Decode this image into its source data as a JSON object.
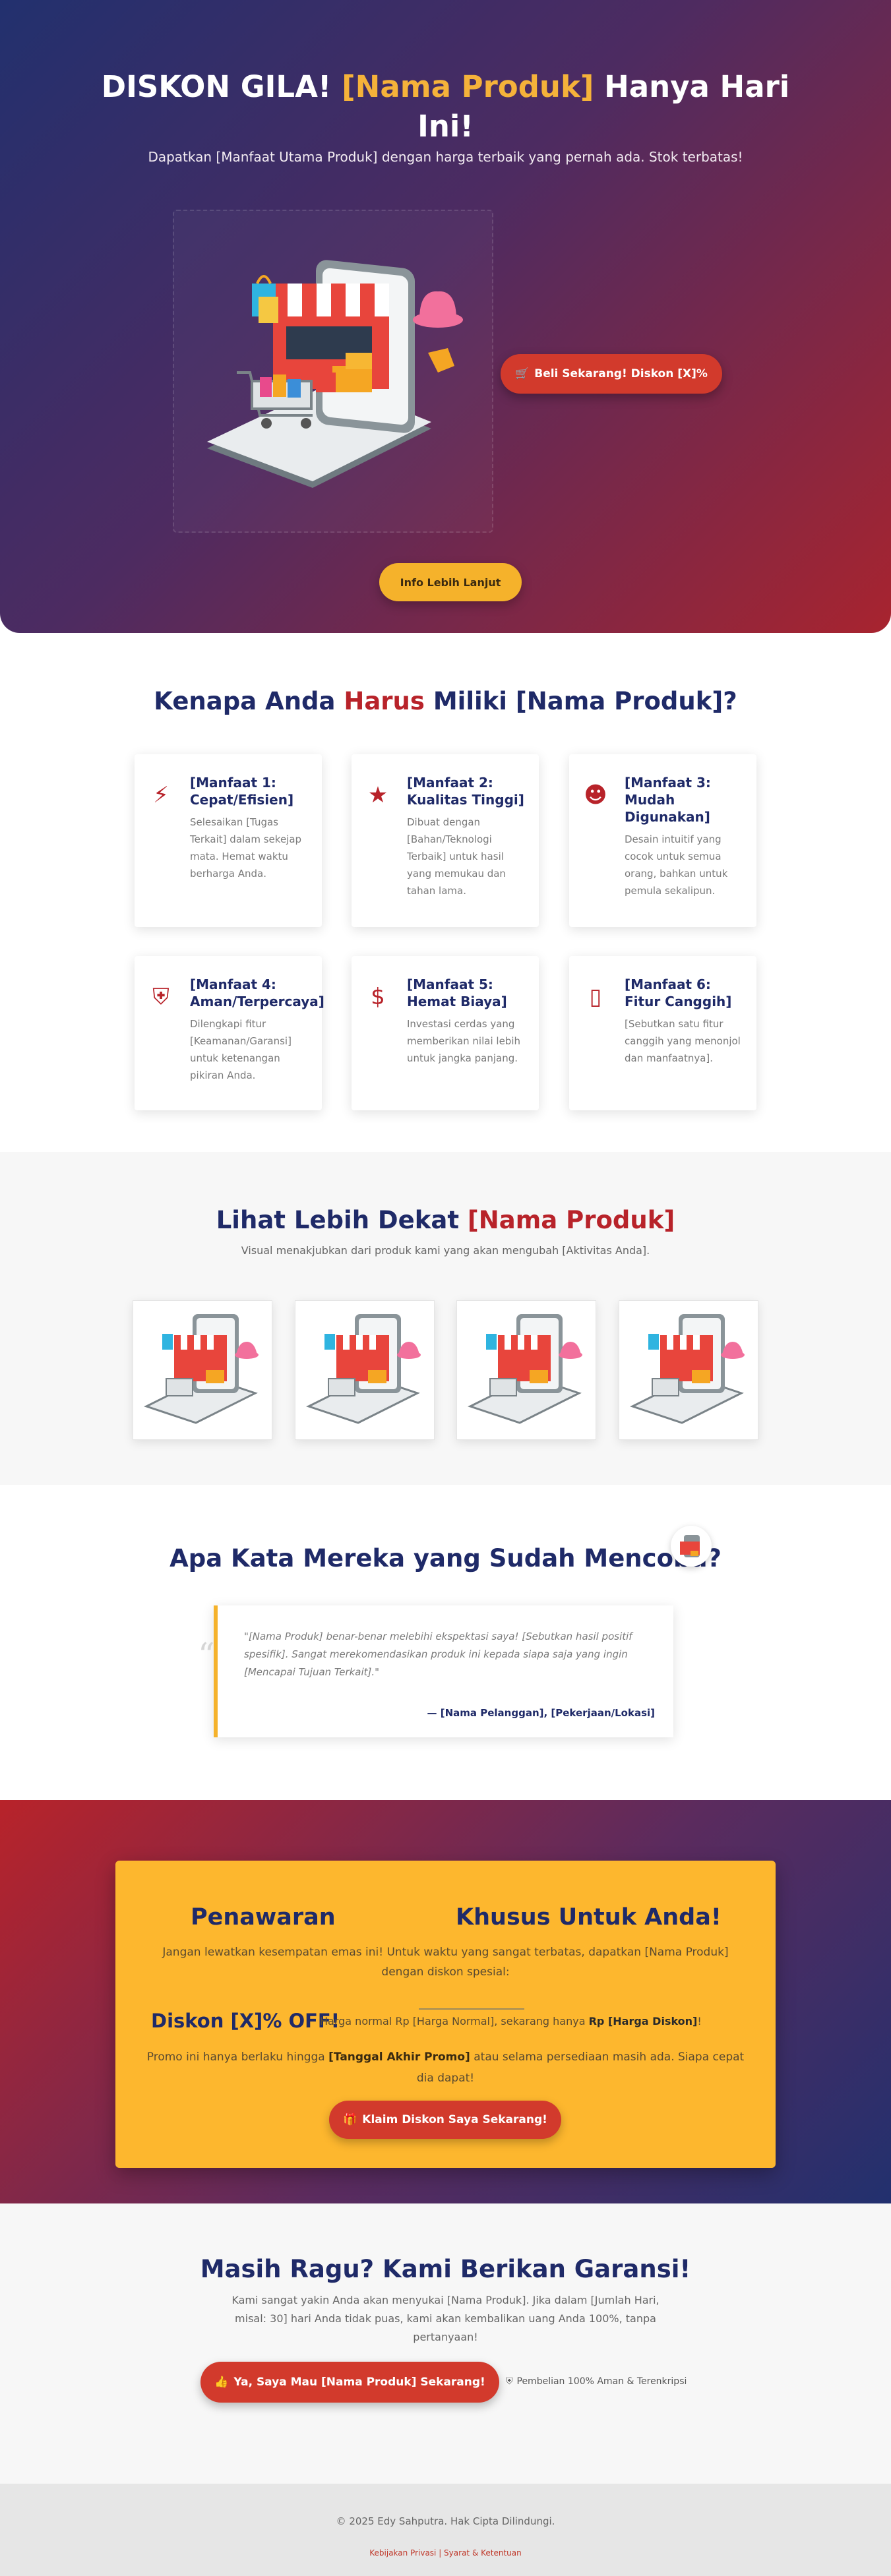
{
  "hero": {
    "title_prefix": "DISKON GILA!",
    "title_product": "[Nama Produk]",
    "title_suffix": "Hanya Hari Ini!",
    "subtitle": "Dapatkan [Manfaat Utama Produk] dengan harga terbaik yang pernah ada. Stok terbatas!",
    "buy_button": "Beli Sekarang! Diskon [X]%",
    "info_button": "Info Lebih Lanjut"
  },
  "benefits": {
    "title_a": "Kenapa Anda",
    "title_b": "Harus",
    "title_c": "Miliki [Nama Produk]?",
    "items": [
      {
        "icon": "bolt-icon",
        "glyph": "⚡",
        "title": "[Manfaat 1: Cepat/Efisien]",
        "text": "Selesaikan [Tugas Terkait] dalam sekejap mata. Hemat waktu berharga Anda."
      },
      {
        "icon": "star-icon",
        "glyph": "★",
        "title": "[Manfaat 2: Kualitas Tinggi]",
        "text": "Dibuat dengan [Bahan/Teknologi Terbaik] untuk hasil yang memukau dan tahan lama."
      },
      {
        "icon": "smile-icon",
        "glyph": "☻",
        "title": "[Manfaat 3: Mudah Digunakan]",
        "text": "Desain intuitif yang cocok untuk semua orang, bahkan untuk pemula sekalipun."
      },
      {
        "icon": "shield-icon",
        "glyph": "⛨",
        "title": "[Manfaat 4: Aman/Terpercaya]",
        "text": "Dilengkapi fitur [Keamanan/Garansi] untuk ketenangan pikiran Anda."
      },
      {
        "icon": "dollar-icon",
        "glyph": "$",
        "title": "[Manfaat 5: Hemat Biaya]",
        "text": "Investasi cerdas yang memberikan nilai lebih untuk jangka panjang."
      },
      {
        "icon": "mobile-icon",
        "glyph": "▯",
        "title": "[Manfaat 6: Fitur Canggih]",
        "text": "[Sebutkan satu fitur canggih yang menonjol dan manfaatnya]."
      }
    ]
  },
  "gallery": {
    "title_a": "Lihat Lebih Dekat",
    "title_b": "[Nama Produk]",
    "subtitle": "Visual menakjubkan dari produk kami yang akan mengubah [Aktivitas Anda]."
  },
  "testimonial": {
    "title": "Apa Kata Mereka yang Sudah Mencoba?",
    "quote": "\"[Nama Produk] benar-benar melebihi ekspektasi saya! [Sebutkan hasil positif spesifik]. Sangat merekomendasikan produk ini kepada siapa saja yang ingin [Mencapai Tujuan Terkait].\"",
    "author": "— [Nama Pelanggan], [Pekerjaan/Lokasi]"
  },
  "offer": {
    "title_a": "Penawaran",
    "title_b": "Khusus Untuk Anda!",
    "desc": "Jangan lewatkan kesempatan emas ini! Untuk waktu yang sangat terbatas, dapatkan [Nama Produk] dengan diskon spesial:",
    "discount": "Diskon [X]% OFF!",
    "normal_a": "Harga normal Rp [Harga Normal], sekarang hanya",
    "normal_b": "Rp [Harga Diskon]",
    "normal_c": "!",
    "promo_a": "Promo ini hanya berlaku hingga",
    "promo_b": "[Tanggal Akhir Promo]",
    "promo_c": "atau selama persediaan masih ada. Siapa cepat dia dapat!",
    "button": "Klaim Diskon Saya Sekarang!"
  },
  "guarantee": {
    "title": "Masih Ragu? Kami Berikan Garansi!",
    "desc": "Kami sangat yakin Anda akan menyukai [Nama Produk]. Jika dalam [Jumlah Hari, misal: 30] hari Anda tidak puas, kami akan kembalikan uang Anda 100%, tanpa pertanyaan!",
    "button": "Ya, Saya Mau [Nama Produk] Sekarang!",
    "secure": "Pembelian 100% Aman & Terenkripsi"
  },
  "footer": {
    "copyright": "© 2025 Edy Sahputra. Hak Cipta Dilindungi.",
    "links": "Kebijakan Privasi | Syarat & Ketentuan"
  }
}
